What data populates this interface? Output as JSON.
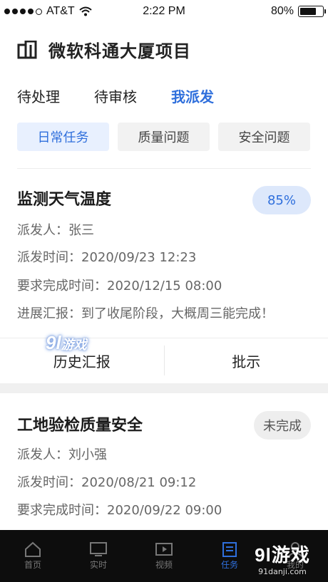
{
  "status_bar": {
    "carrier": "AT&T",
    "time": "2:22 PM",
    "battery": "80%",
    "battery_level": 0.8
  },
  "header": {
    "title": "微软科通大厦项目",
    "icon": "building-icon"
  },
  "tabs": [
    {
      "label": "待处理",
      "active": false
    },
    {
      "label": "待审核",
      "active": false
    },
    {
      "label": "我派发",
      "active": true
    }
  ],
  "chips": [
    {
      "label": "日常任务",
      "active": true
    },
    {
      "label": "质量问题",
      "active": false
    },
    {
      "label": "安全问题",
      "active": false
    }
  ],
  "tasks": [
    {
      "title": "监测天气温度",
      "badge": "85%",
      "progress": 0.85,
      "rows": [
        "派发人：张三",
        "派发时间：2020/09/23 12:23",
        "要求完成时间：2020/12/15 08:00",
        "进展汇报：到了收尾阶段，大概周三能完成！"
      ],
      "actions": [
        "历史汇报",
        "批示"
      ]
    },
    {
      "title": "工地验检质量安全",
      "badge": "未完成",
      "rows": [
        "派发人：刘小强",
        "派发时间：2020/08/21 09:12",
        "要求完成时间：2020/09/22 09:00"
      ]
    }
  ],
  "bottom_nav": [
    {
      "label": "首页",
      "icon": "home-icon"
    },
    {
      "label": "实时",
      "icon": "monitor-icon"
    },
    {
      "label": "视频",
      "icon": "video-icon"
    },
    {
      "label": "任务",
      "icon": "task-icon",
      "active": true
    },
    {
      "label": "我的",
      "icon": "user-icon"
    }
  ],
  "watermark_left": {
    "logo": "9l",
    "text": "游戏"
  },
  "watermark_right": {
    "logo": "9l游戏",
    "url": "91danji.com"
  },
  "colors": {
    "accent": "#2f6fdc",
    "accent_bg": "#e8f0fe",
    "badge_bg": "#dde8fb"
  }
}
